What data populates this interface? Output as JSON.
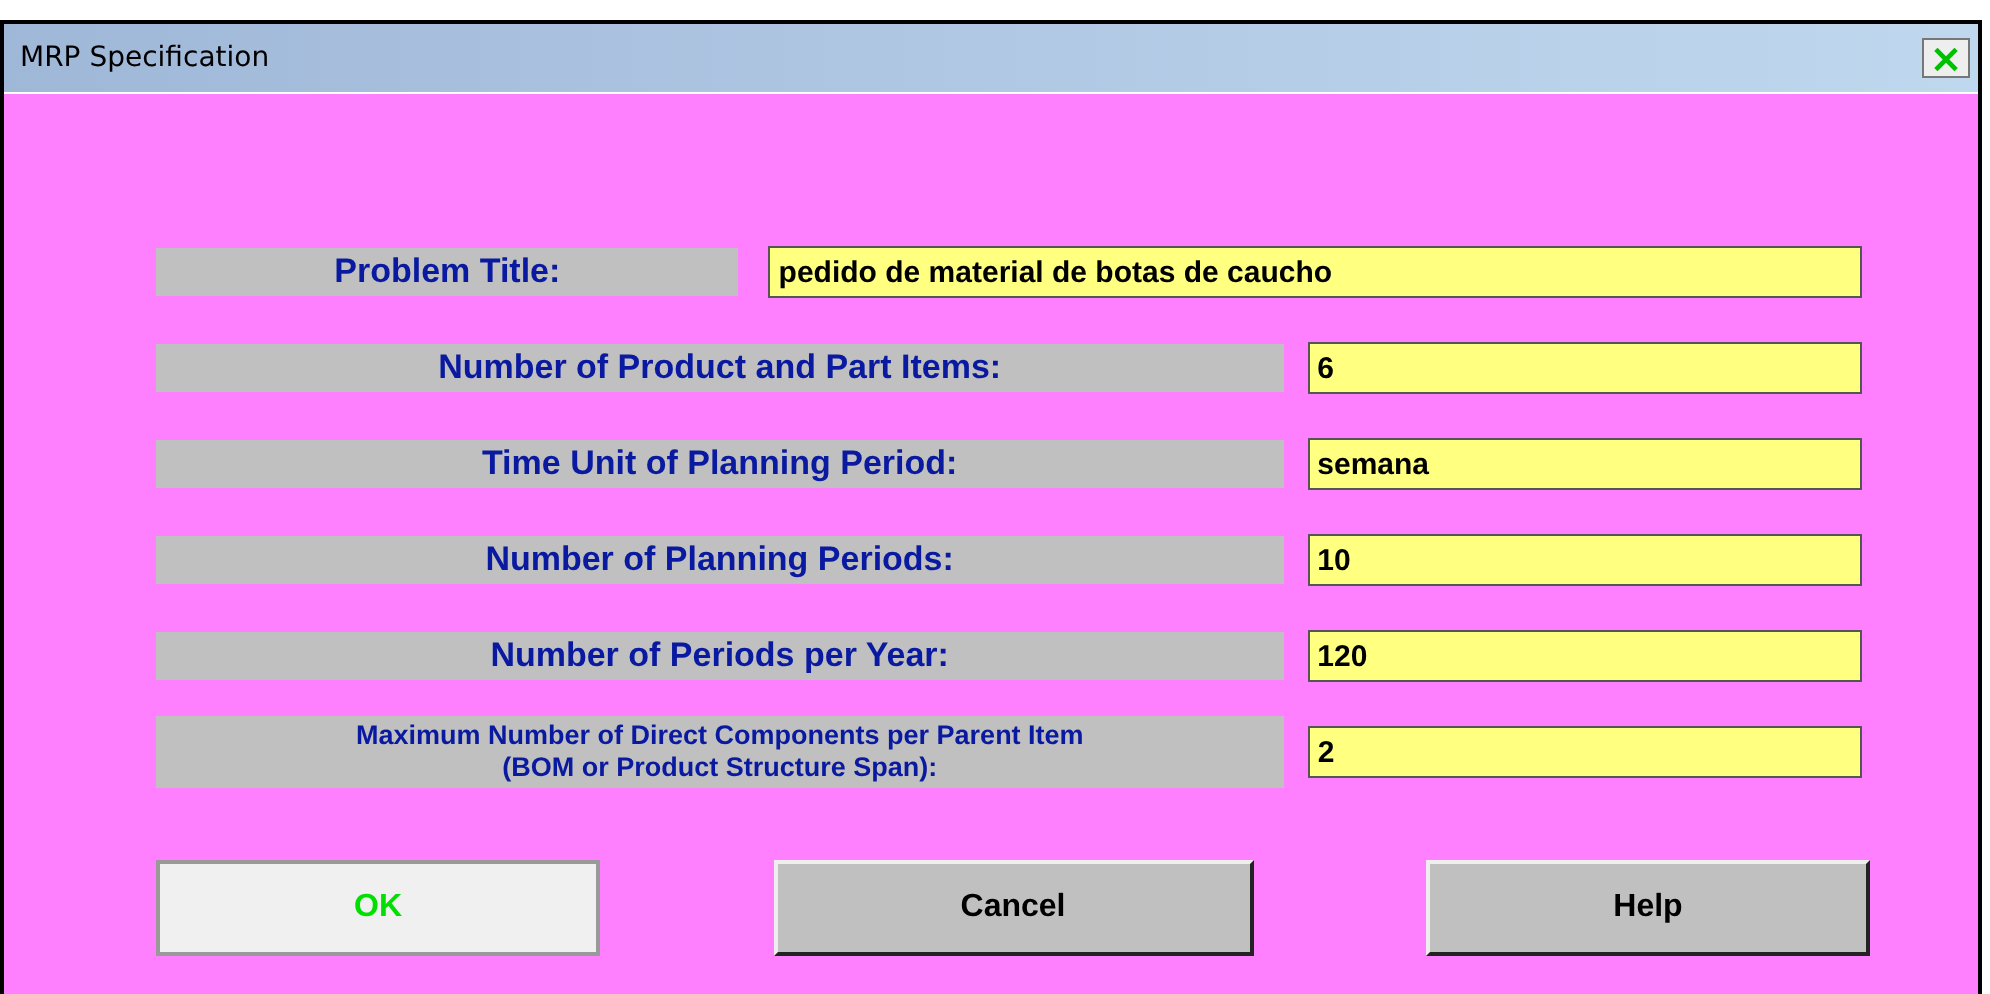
{
  "window": {
    "title": "MRP Specification",
    "close": "×"
  },
  "title_row": {
    "label": "Problem Title:",
    "value": "pedido de material de botas de caucho"
  },
  "fields": [
    {
      "label": "Number of Product and Part Items:",
      "value": "6",
      "small": false
    },
    {
      "label": "Time Unit of Planning Period:",
      "value": "semana",
      "small": false
    },
    {
      "label": "Number of Planning Periods:",
      "value": "10",
      "small": false
    },
    {
      "label": "Number of Periods per Year:",
      "value": "120",
      "small": false
    },
    {
      "label": "Maximum Number of Direct Components per Parent Item (BOM or Product Structure Span):",
      "value": "2",
      "small": true
    }
  ],
  "buttons": [
    {
      "label": "OK",
      "focused": true
    },
    {
      "label": "Cancel",
      "focused": false
    },
    {
      "label": "Help",
      "focused": false
    }
  ]
}
